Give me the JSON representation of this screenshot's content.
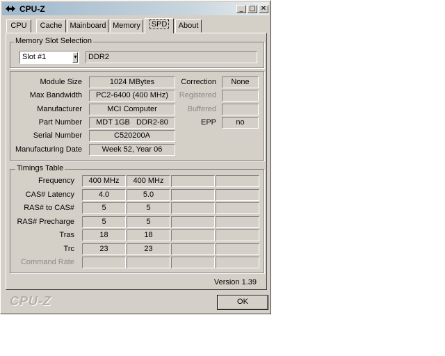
{
  "window": {
    "title": "CPU-Z"
  },
  "titlebar_buttons": {
    "minimize": "_",
    "maximize": "□",
    "close": "✕"
  },
  "tabs": [
    {
      "label": "CPU"
    },
    {
      "label": "Cache"
    },
    {
      "label": "Mainboard"
    },
    {
      "label": "Memory"
    },
    {
      "label": "SPD",
      "active": true
    },
    {
      "label": "About"
    }
  ],
  "slot_section": {
    "label": "Memory Slot Selection",
    "selected_slot": "Slot #1",
    "memory_type": "DDR2"
  },
  "module": {
    "labels": {
      "size": "Module Size",
      "bandwidth": "Max Bandwidth",
      "manufacturer": "Manufacturer",
      "part": "Part Number",
      "serial": "Serial Number",
      "date": "Manufacturing Date",
      "correction": "Correction",
      "registered": "Registered",
      "buffered": "Buffered",
      "epp": "EPP"
    },
    "values": {
      "size": "1024 MBytes",
      "bandwidth": "PC2-6400 (400 MHz)",
      "manufacturer": "MCI Computer",
      "part": "MDT 1GB   DDR2-80",
      "serial": "C520200A",
      "date": "Week 52, Year 06",
      "correction": "None",
      "registered": "",
      "buffered": "",
      "epp": "no"
    }
  },
  "timings": {
    "label": "Timings Table",
    "rows": [
      {
        "label": "Frequency",
        "values": [
          "400 MHz",
          "400 MHz",
          "",
          ""
        ]
      },
      {
        "label": "CAS# Latency",
        "values": [
          "4.0",
          "5.0",
          "",
          ""
        ]
      },
      {
        "label": "RAS# to CAS#",
        "values": [
          "5",
          "5",
          "",
          ""
        ]
      },
      {
        "label": "RAS# Precharge",
        "values": [
          "5",
          "5",
          "",
          ""
        ]
      },
      {
        "label": "Tras",
        "values": [
          "18",
          "18",
          "",
          ""
        ]
      },
      {
        "label": "Trc",
        "values": [
          "23",
          "23",
          "",
          ""
        ]
      },
      {
        "label": "Command Rate",
        "values": [
          "",
          "",
          "",
          ""
        ],
        "disabled": true
      }
    ]
  },
  "footer": {
    "version": "Version 1.39",
    "brand": "CPU-Z",
    "ok_label": "OK"
  },
  "colors": {
    "face": "#d4d0c8",
    "disabled_text": "#8a8a8a",
    "title_gradient_start": "#9fb8cc"
  }
}
